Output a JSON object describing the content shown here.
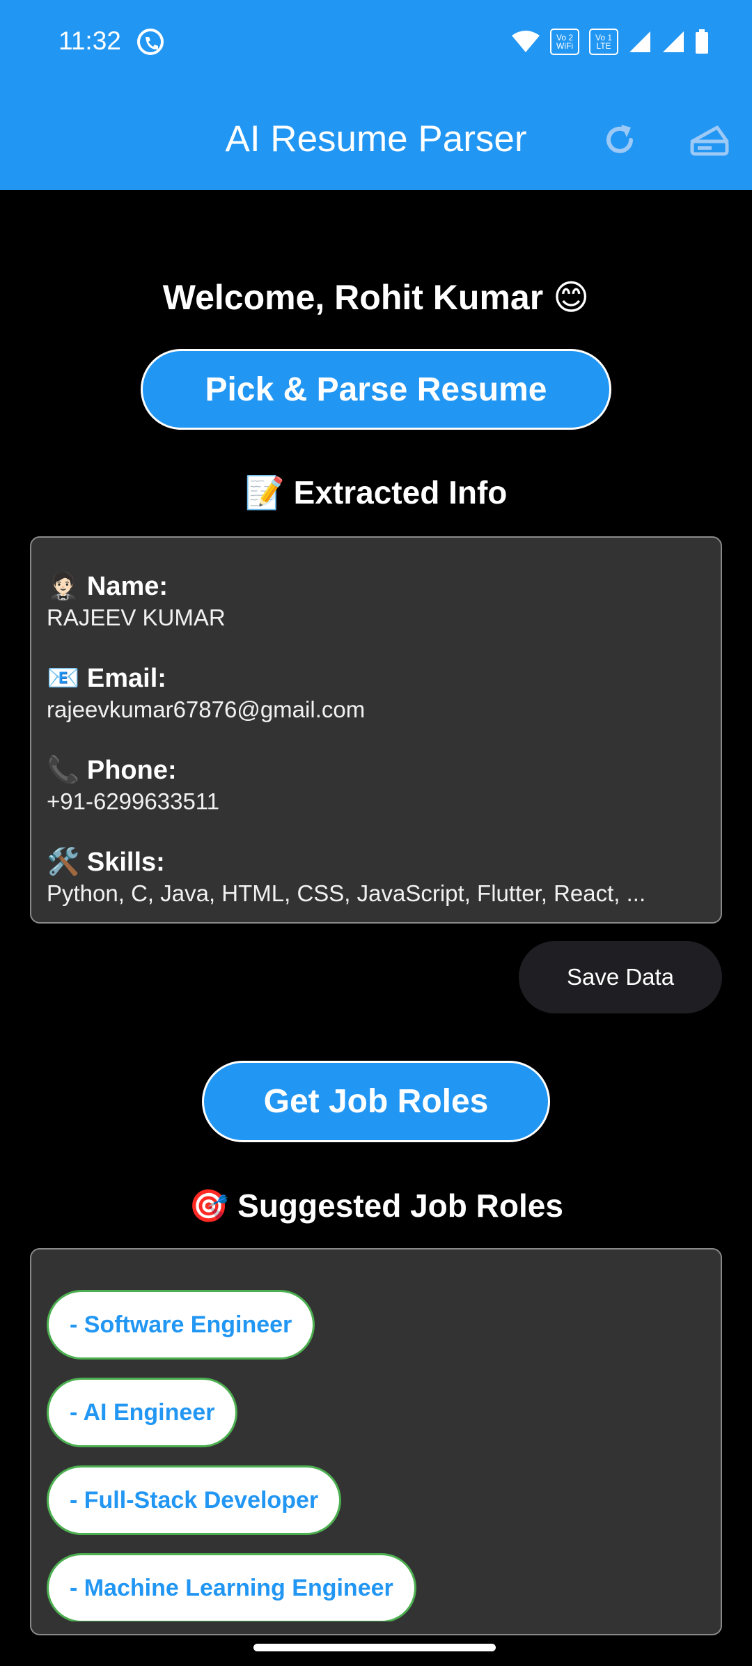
{
  "status_bar": {
    "time": "11:32",
    "icons": [
      "call-icon",
      "wifi-icon",
      "volte-wifi-icon",
      "volte-lte-icon",
      "signal-icon",
      "signal-icon",
      "battery-icon"
    ],
    "volte_wifi_top": "Vo 2",
    "volte_wifi_bottom": "WiFi",
    "volte_lte_top": "Vo 1",
    "volte_lte_bottom": "LTE"
  },
  "app_bar": {
    "title": "AI Resume Parser",
    "actions": [
      "refresh-icon",
      "clear-icon"
    ]
  },
  "welcome": "Welcome, Rohit Kumar 😊",
  "pick_button": "Pick & Parse Resume",
  "extracted": {
    "heading": "📝 Extracted Info",
    "fields": [
      {
        "label": "🤵🏻 Name:",
        "value": "RAJEEV KUMAR"
      },
      {
        "label": "📧 Email:",
        "value": "rajeevkumar67876@gmail.com"
      },
      {
        "label": "📞 Phone:",
        "value": "+91-6299633511"
      },
      {
        "label": "🛠️ Skills:",
        "value": "Python, C, Java, HTML, CSS, JavaScript, Flutter, React, ..."
      }
    ]
  },
  "save_button": "Save Data",
  "jobs_button": "Get Job Roles",
  "suggested": {
    "heading": "🎯 Suggested Job Roles",
    "roles": [
      "- Software Engineer",
      "- AI Engineer",
      "- Full-Stack Developer",
      "- Machine Learning Engineer"
    ]
  },
  "colors": {
    "primary": "#2196F3",
    "background": "#000000",
    "card": "#333333",
    "chip_border": "#4CAF50",
    "save_button": "#1f1f23"
  }
}
